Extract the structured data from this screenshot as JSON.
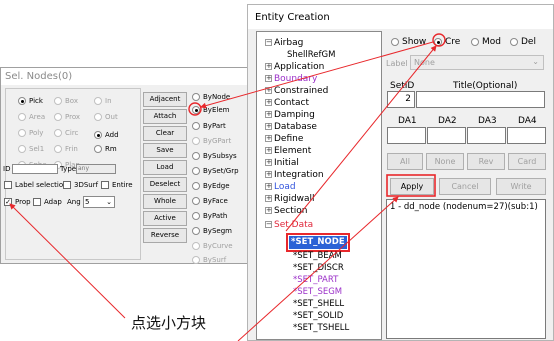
{
  "sel_nodes": {
    "title": "Sel. Nodes(0)",
    "radio_col1": [
      {
        "label": "Pick",
        "checked": true,
        "enabled": true
      },
      {
        "label": "Area",
        "checked": false,
        "enabled": false
      },
      {
        "label": "Poly",
        "checked": false,
        "enabled": false
      },
      {
        "label": "Sel1",
        "checked": false,
        "enabled": false
      },
      {
        "label": "Sphe",
        "checked": false,
        "enabled": false
      }
    ],
    "radio_col2": [
      {
        "label": "Box",
        "checked": false,
        "enabled": false
      },
      {
        "label": "Prox",
        "checked": false,
        "enabled": false
      },
      {
        "label": "Circ",
        "checked": false,
        "enabled": false
      },
      {
        "label": "Frin",
        "checked": false,
        "enabled": false
      },
      {
        "label": "Plan",
        "checked": false,
        "enabled": false
      }
    ],
    "radio_col3": [
      {
        "label": "In",
        "checked": false,
        "enabled": false
      },
      {
        "label": "Out",
        "checked": false,
        "enabled": false
      },
      {
        "label": "Add",
        "checked": true,
        "enabled": true
      },
      {
        "label": "Rm",
        "checked": false,
        "enabled": true
      }
    ],
    "id_label": "ID",
    "type_label": "Type",
    "type_value": "any",
    "checks_row1": [
      {
        "label": "Label selection",
        "checked": false
      },
      {
        "label": "3DSurf",
        "checked": false
      },
      {
        "label": "Entire",
        "checked": false
      }
    ],
    "checks_row2": [
      {
        "label": "Prop",
        "checked": true
      },
      {
        "label": "Adap",
        "checked": false
      }
    ],
    "ang_label": "Ang",
    "ang_value": "5",
    "buttons": [
      "Adjacent",
      "Attach",
      "Clear",
      "Save",
      "Load",
      "Deselect",
      "Whole",
      "Active",
      "Reverse"
    ],
    "by_options": [
      {
        "label": "ByNode",
        "checked": false,
        "enabled": true
      },
      {
        "label": "ByElem",
        "checked": true,
        "enabled": true
      },
      {
        "label": "ByPart",
        "checked": false,
        "enabled": true
      },
      {
        "label": "ByGPart",
        "checked": false,
        "enabled": false
      },
      {
        "label": "BySubsys",
        "checked": false,
        "enabled": true
      },
      {
        "label": "BySet/Grp",
        "checked": false,
        "enabled": true
      },
      {
        "label": "ByEdge",
        "checked": false,
        "enabled": true
      },
      {
        "label": "ByFace",
        "checked": false,
        "enabled": true
      },
      {
        "label": "ByPath",
        "checked": false,
        "enabled": true
      },
      {
        "label": "BySegm",
        "checked": false,
        "enabled": true
      },
      {
        "label": "ByCurve",
        "checked": false,
        "enabled": false
      },
      {
        "label": "BySurf",
        "checked": false,
        "enabled": false
      }
    ]
  },
  "entity_creation": {
    "title": "Entity Creation",
    "tree": [
      {
        "label": "Airbag",
        "expander": "−",
        "color": "black"
      },
      {
        "label": "ShellRefGM",
        "expander": "",
        "color": "black"
      },
      {
        "label": "Application",
        "expander": "+",
        "color": "black"
      },
      {
        "label": "Boundary",
        "expander": "+",
        "color": "purple"
      },
      {
        "label": "Constrained",
        "expander": "+",
        "color": "black"
      },
      {
        "label": "Contact",
        "expander": "+",
        "color": "black"
      },
      {
        "label": "Damping",
        "expander": "+",
        "color": "black"
      },
      {
        "label": "Database",
        "expander": "+",
        "color": "black"
      },
      {
        "label": "Define",
        "expander": "+",
        "color": "black"
      },
      {
        "label": "Element",
        "expander": "+",
        "color": "black"
      },
      {
        "label": "Initial",
        "expander": "+",
        "color": "black"
      },
      {
        "label": "Integration",
        "expander": "+",
        "color": "black"
      },
      {
        "label": "Load",
        "expander": "+",
        "color": "blue"
      },
      {
        "label": "Rigidwall",
        "expander": "+",
        "color": "black"
      },
      {
        "label": "Section",
        "expander": "+",
        "color": "black"
      },
      {
        "label": "Set Data",
        "expander": "−",
        "color": "red"
      }
    ],
    "set_items": [
      {
        "label": "*SET_NODE",
        "color": "selected"
      },
      {
        "label": "*SET_BEAM",
        "color": "black"
      },
      {
        "label": "*SET_DISCR",
        "color": "black"
      },
      {
        "label": "*SET_PART",
        "color": "purple"
      },
      {
        "label": "*SET_SEGM",
        "color": "purple"
      },
      {
        "label": "*SET_SHELL",
        "color": "black"
      },
      {
        "label": "*SET_SOLID",
        "color": "black"
      },
      {
        "label": "*SET_TSHELL",
        "color": "black"
      }
    ],
    "modes": [
      {
        "label": "Show",
        "checked": false
      },
      {
        "label": "Cre",
        "checked": true
      },
      {
        "label": "Mod",
        "checked": false
      },
      {
        "label": "Del",
        "checked": false
      }
    ],
    "label_text": "Label",
    "label_value": "None",
    "headers1": [
      "SetID",
      "Title(Optional)"
    ],
    "setid_value": "2",
    "title_value": "",
    "headers2": [
      "DA1",
      "DA2",
      "DA3",
      "DA4"
    ],
    "row_buttons": [
      "All",
      "None",
      "Rev",
      "Card"
    ],
    "action_buttons": [
      "Apply",
      "Cancel",
      "Write"
    ],
    "list_item": "1 - dd_node (nodenum=27)(sub:1)"
  },
  "annotation": {
    "text": "点选小方块",
    "highlight_color": "#e8282c"
  }
}
